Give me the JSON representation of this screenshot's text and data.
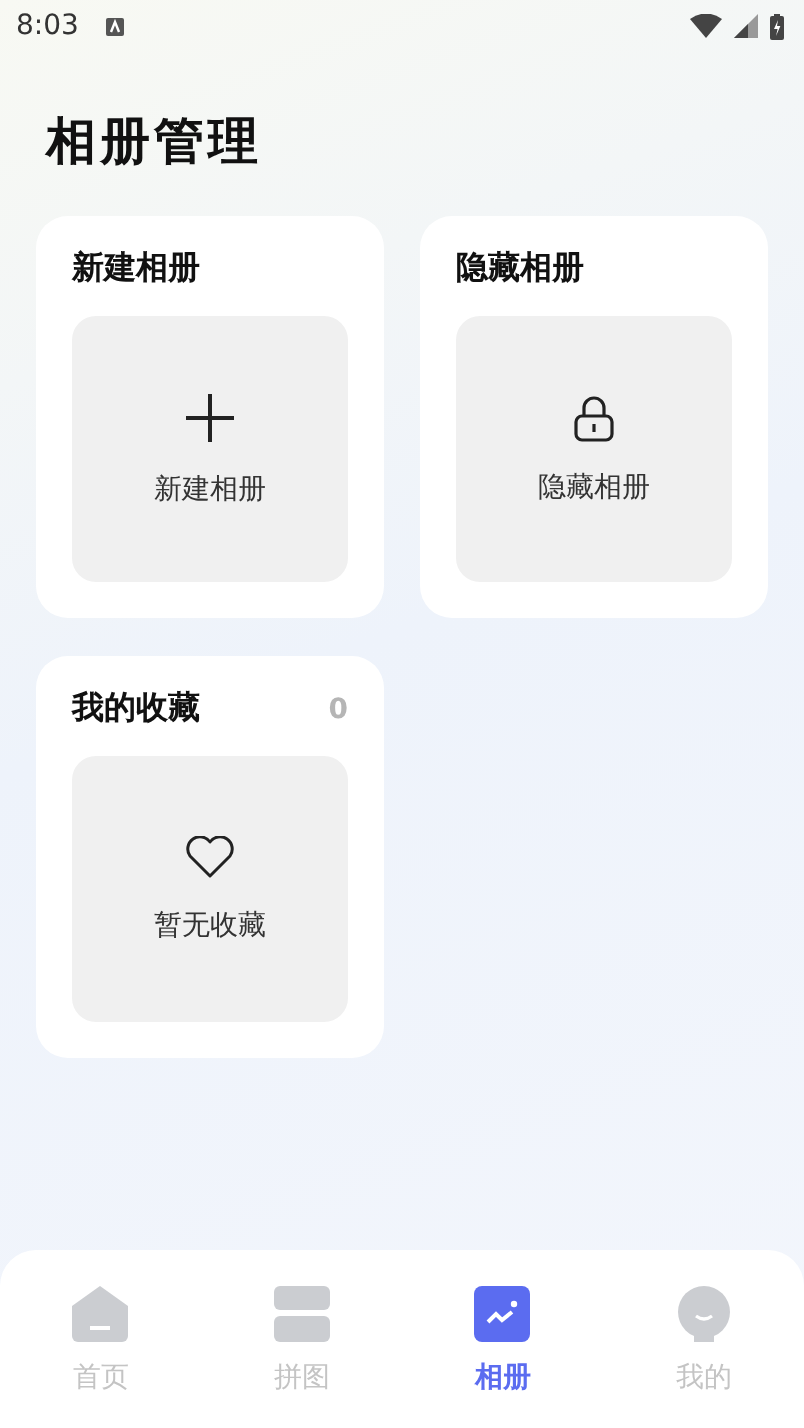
{
  "status_bar": {
    "time": "8:03"
  },
  "title": "相册管理",
  "cards": [
    {
      "title": "新建相册",
      "kind": "create",
      "label": "新建相册"
    },
    {
      "title": "隐藏相册",
      "kind": "hidden",
      "label": "隐藏相册"
    },
    {
      "title": "我的收藏",
      "kind": "favorites",
      "label": "暂无收藏",
      "count": "0"
    }
  ],
  "tabs": [
    {
      "label": "首页",
      "kind": "home",
      "selected": false
    },
    {
      "label": "拼图",
      "kind": "collage",
      "selected": false
    },
    {
      "label": "相册",
      "kind": "album",
      "selected": true
    },
    {
      "label": "我的",
      "kind": "profile",
      "selected": false
    }
  ]
}
